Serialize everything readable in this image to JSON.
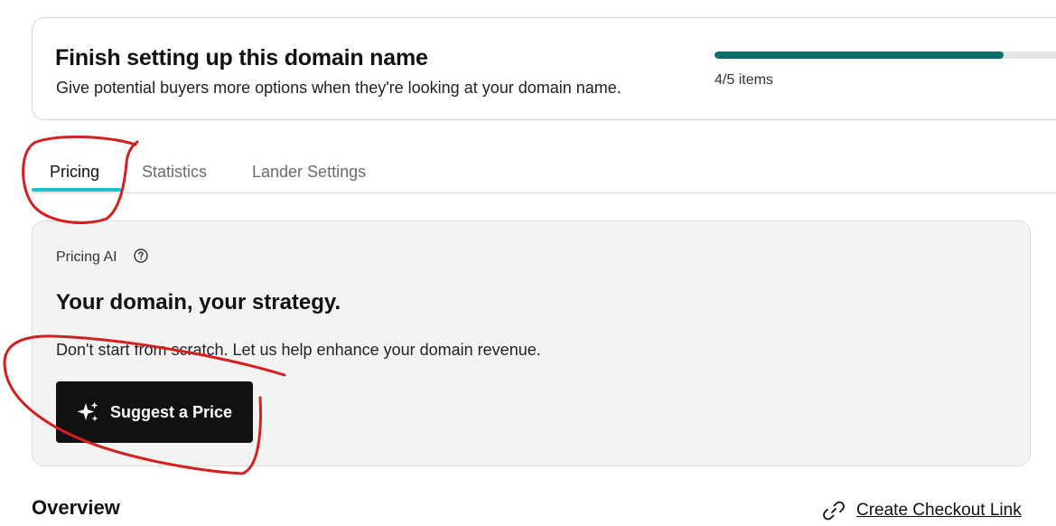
{
  "setup": {
    "title": "Finish setting up this domain name",
    "subtitle": "Give potential buyers more options when they're looking at your domain name.",
    "progress_label": "4/5 items",
    "progress_fraction": 0.8,
    "progress_color": "#0b6f6c"
  },
  "tabs": [
    {
      "label": "Pricing",
      "active": true
    },
    {
      "label": "Statistics",
      "active": false
    },
    {
      "label": "Lander Settings",
      "active": false
    }
  ],
  "tab_accent_color": "#1ec2c9",
  "pricing_ai": {
    "label": "Pricing AI",
    "help_icon": "question-circle-icon",
    "heading": "Your domain, your strategy.",
    "description": "Don't start from scratch. Let us help enhance your domain revenue.",
    "button_label": "Suggest a Price",
    "button_icon": "sparkle-icon"
  },
  "overview": {
    "title": "Overview",
    "link_label": "Create Checkout Link",
    "link_icon": "link-icon"
  },
  "annotation_color": "#d42020"
}
